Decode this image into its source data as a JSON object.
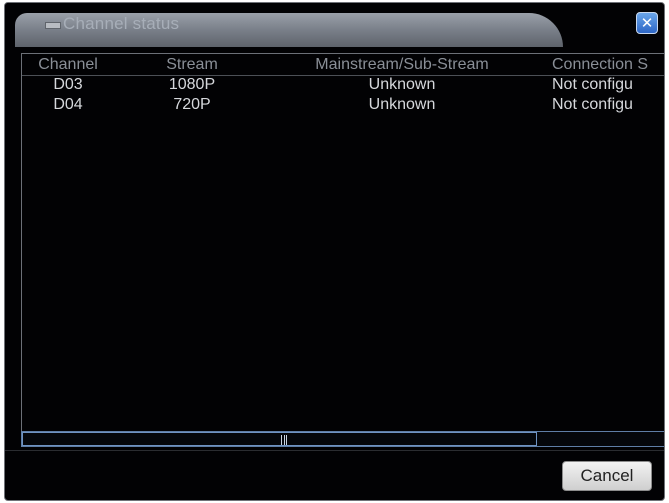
{
  "window": {
    "title": "Channel status",
    "close_glyph": "✕"
  },
  "table": {
    "columns": [
      "Channel",
      "Stream",
      "Mainstream/Sub-Stream",
      "Connection S"
    ],
    "rows": [
      {
        "channel": "D03",
        "stream": "1080P",
        "main_sub": "Unknown",
        "connection": "Not configu"
      },
      {
        "channel": "D04",
        "stream": "720P",
        "main_sub": "Unknown",
        "connection": "Not configu"
      }
    ]
  },
  "buttons": {
    "cancel_label": "Cancel"
  },
  "colors": {
    "background": "#020204",
    "title_bar": "#7c828c",
    "close_button": "#2d66c6",
    "text": "#d6d8dc",
    "header_text": "#8a8f97"
  },
  "icons": {
    "title": "window-icon",
    "close": "close-icon",
    "scroll_grip": "scroll-grip-icon"
  }
}
